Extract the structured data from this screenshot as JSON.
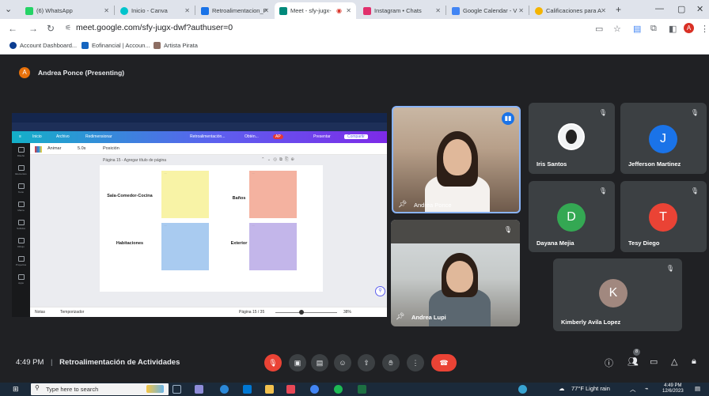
{
  "browser": {
    "tabs": [
      {
        "label": "(6) WhatsApp",
        "color": "#25d366"
      },
      {
        "label": "Inicio - Canva",
        "color": "#00c4cc"
      },
      {
        "label": "Retroalimentacion_P",
        "color": "#1a73e8"
      },
      {
        "label": "Meet - sfy-jugx-",
        "color": "#00897b",
        "active": true
      },
      {
        "label": "Instagram • Chats",
        "color": "#e1306c"
      },
      {
        "label": "Google Calendar - V",
        "color": "#4285f4"
      },
      {
        "label": "Calificaciones para A",
        "color": "#f4b400"
      }
    ],
    "new_tab": "+",
    "url": "meet.google.com/sfy-jugx-dwf?authuser=0",
    "bookmarks": [
      {
        "label": "Account Dashboard..."
      },
      {
        "label": "Eofinancial | Accoun..."
      },
      {
        "label": "Artista Pirata"
      }
    ]
  },
  "meet": {
    "presenter_initial": "A",
    "presenter_label": "Andrea Ponce (Presenting)",
    "participants": [
      {
        "name": "Andrea Ponce",
        "type": "video"
      },
      {
        "name": "Andrea Lupi",
        "type": "video"
      },
      {
        "name": "Iris Santos",
        "type": "photo"
      },
      {
        "name": "Jefferson Martinez",
        "initial": "J",
        "color": "#1a73e8"
      },
      {
        "name": "Dayana Mejia",
        "initial": "D",
        "color": "#34a853"
      },
      {
        "name": "Tesy Diego",
        "initial": "T",
        "color": "#ea4335"
      },
      {
        "name": "Kimberly Avila Lopez",
        "initial": "K",
        "color": "#a1887f"
      }
    ],
    "time": "4:49 PM",
    "separator": "|",
    "meeting_title": "Retroalimentación de Actividades",
    "people_count": "8"
  },
  "canva": {
    "menu": [
      "Inicio",
      "Archivo",
      "Redimensionar",
      "Retroalimentación...",
      "Obtén...",
      "Presentar",
      "Compartir"
    ],
    "menu_badge": "AP",
    "side": [
      "Diseño",
      "Elementos",
      "Texto",
      "Marca",
      "Subidos",
      "Dibujo",
      "Proyectos",
      "Apps"
    ],
    "tools": {
      "animate": "Animar",
      "duration": "5.0s",
      "position": "Posición"
    },
    "page_label": "Página 15 - Agregar título de página",
    "rooms": [
      {
        "label": "Sala-Comedor-Cocina",
        "color": "#f8f3a6"
      },
      {
        "label": "Baños",
        "color": "#f4b2a0"
      },
      {
        "label": "Habitaciones",
        "color": "#a9cbf0"
      },
      {
        "label": "Exterior",
        "color": "#c3b6ea"
      }
    ],
    "notes": "Notas",
    "timer": "Temporizador",
    "page_count": "Página 15 / 35",
    "zoom": "38%"
  },
  "taskbar": {
    "search_placeholder": "Type here to search",
    "weather": "77°F  Light rain",
    "time": "4:49 PM",
    "date": "12/6/2023"
  }
}
